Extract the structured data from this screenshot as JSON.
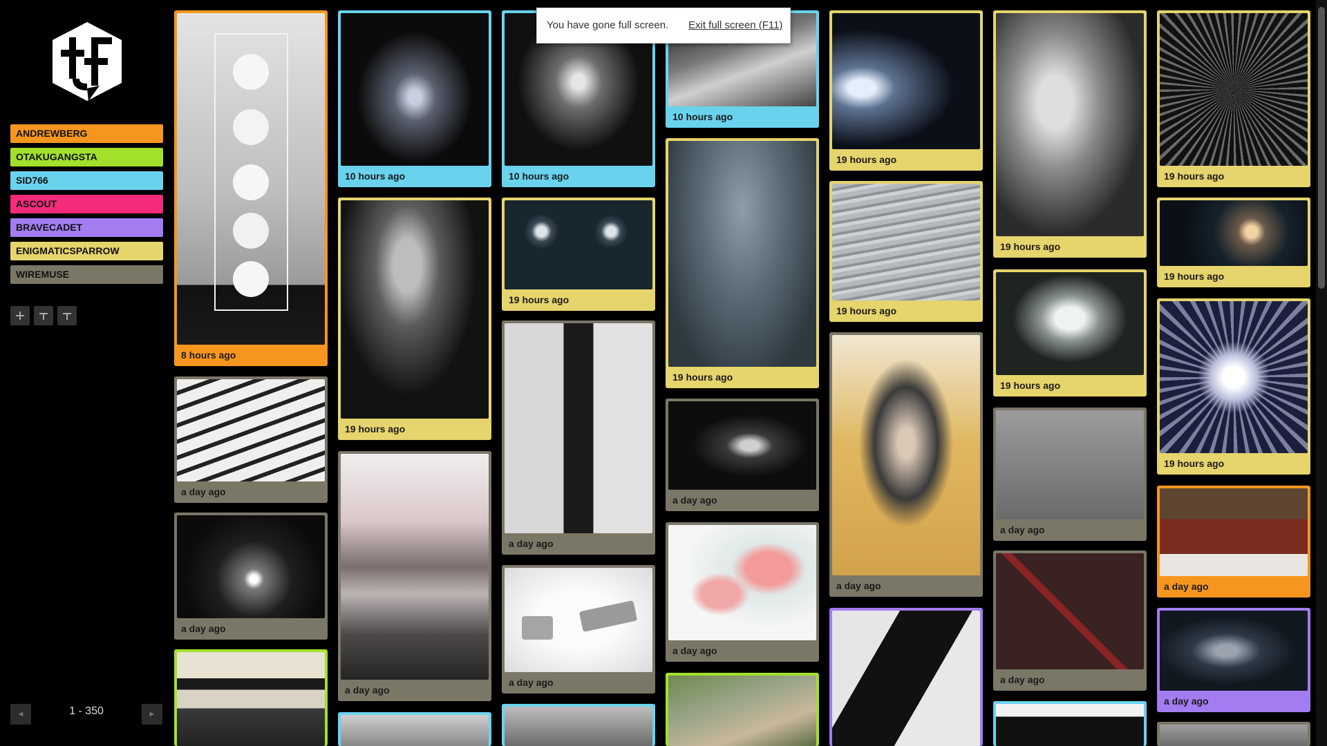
{
  "colors": {
    "andrewberg": "#f7961e",
    "otakugangsta": "#a3e02c",
    "sid766": "#69d3ee",
    "ascout": "#f42a7b",
    "bravecadet": "#a27cf0",
    "enigmaticsparrow": "#e6d46c",
    "wiremuse": "#7b7767"
  },
  "sidebar": {
    "logo_icon": "tf-cube-logo",
    "users": [
      "ANDREWBERG",
      "OTAKUGANGSTA",
      "SID766",
      "ASCOUT",
      "BRAVECADET",
      "ENIGMATICSPARROW",
      "WIREMUSE"
    ],
    "toolbar_icons": [
      "plus-icon",
      "filter-icon",
      "filter-icon"
    ]
  },
  "pager": {
    "prev_symbol": "◄",
    "next_symbol": "►",
    "range": "1 - 350"
  },
  "fullscreen_notice": {
    "text": "You have gone full screen.",
    "exit_label": "Exit full screen (F11)"
  },
  "tiles": [
    {
      "user": "andrewberg",
      "time": "8 hours ago"
    },
    {
      "user": "wiremuse",
      "time": "a day ago"
    },
    {
      "user": "wiremuse",
      "time": "a day ago"
    },
    {
      "user": "otakugangsta",
      "time": ""
    },
    {
      "user": "sid766",
      "time": "10 hours ago"
    },
    {
      "user": "enigmaticsparrow",
      "time": "19 hours ago"
    },
    {
      "user": "wiremuse",
      "time": "a day ago"
    },
    {
      "user": "sid766",
      "time": ""
    },
    {
      "user": "sid766",
      "time": "10 hours ago"
    },
    {
      "user": "enigmaticsparrow",
      "time": "19 hours ago"
    },
    {
      "user": "wiremuse",
      "time": "a day ago"
    },
    {
      "user": "wiremuse",
      "time": "a day ago"
    },
    {
      "user": "sid766",
      "time": ""
    },
    {
      "user": "sid766",
      "time": "10 hours ago"
    },
    {
      "user": "enigmaticsparrow",
      "time": "19 hours ago"
    },
    {
      "user": "wiremuse",
      "time": "a day ago"
    },
    {
      "user": "wiremuse",
      "time": "a day ago"
    },
    {
      "user": "otakugangsta",
      "time": ""
    },
    {
      "user": "enigmaticsparrow",
      "time": "19 hours ago"
    },
    {
      "user": "enigmaticsparrow",
      "time": "19 hours ago"
    },
    {
      "user": "wiremuse",
      "time": "a day ago"
    },
    {
      "user": "bravecadet",
      "time": ""
    },
    {
      "user": "enigmaticsparrow",
      "time": "19 hours ago"
    },
    {
      "user": "enigmaticsparrow",
      "time": "19 hours ago"
    },
    {
      "user": "wiremuse",
      "time": "a day ago"
    },
    {
      "user": "wiremuse",
      "time": "a day ago"
    },
    {
      "user": "sid766",
      "time": ""
    },
    {
      "user": "enigmaticsparrow",
      "time": "19 hours ago"
    },
    {
      "user": "enigmaticsparrow",
      "time": "19 hours ago"
    },
    {
      "user": "enigmaticsparrow",
      "time": "19 hours ago"
    },
    {
      "user": "andrewberg",
      "time": "a day ago"
    },
    {
      "user": "bravecadet",
      "time": "a day ago"
    },
    {
      "user": "wiremuse",
      "time": ""
    }
  ]
}
